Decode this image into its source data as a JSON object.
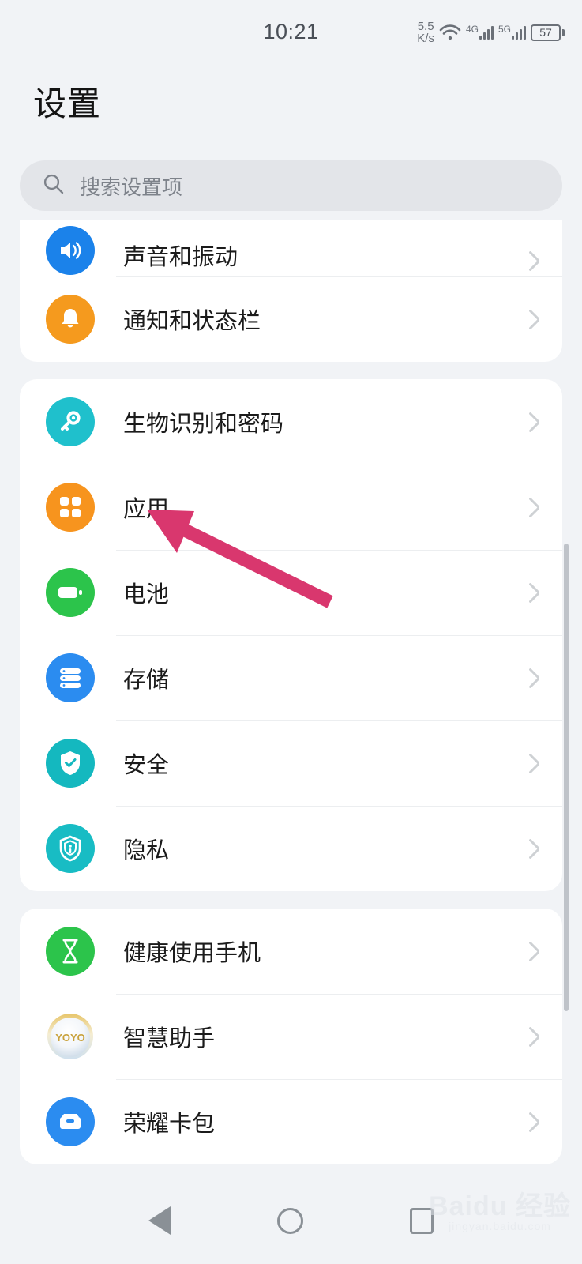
{
  "statusbar": {
    "clock": "10:21",
    "net_speed_value": "5.5",
    "net_speed_unit": "K/s",
    "wifi_icon": "wifi-icon",
    "sim1_network": "4G",
    "sim2_network": "5G",
    "battery_level": "57"
  },
  "header": {
    "title": "设置"
  },
  "search": {
    "placeholder": "搜索设置项",
    "icon": "search-icon"
  },
  "cards": [
    {
      "name": "card-sound-notifications",
      "rows": [
        {
          "label": "声音和振动",
          "icon": "speaker-icon",
          "color": "#1b82ea",
          "clipped": true
        },
        {
          "label": "通知和状态栏",
          "icon": "bell-icon",
          "color": "#f59a1e",
          "clipped": false
        }
      ]
    },
    {
      "name": "card-system-core",
      "rows": [
        {
          "label": "生物识别和密码",
          "icon": "key-icon",
          "color": "#1fc0cc",
          "clipped": false
        },
        {
          "label": "应用",
          "icon": "grid-apps-icon",
          "color": "#f7941e",
          "clipped": false
        },
        {
          "label": "电池",
          "icon": "battery-icon",
          "color": "#2cc44b",
          "clipped": false
        },
        {
          "label": "存储",
          "icon": "storage-icon",
          "color": "#2b8cf0",
          "clipped": false
        },
        {
          "label": "安全",
          "icon": "shield-check-icon",
          "color": "#14b8bf",
          "clipped": false
        },
        {
          "label": "隐私",
          "icon": "privacy-lock-icon",
          "color": "#18bcc4",
          "clipped": false
        }
      ]
    },
    {
      "name": "card-digital-balance",
      "rows": [
        {
          "label": "健康使用手机",
          "icon": "hourglass-icon",
          "color": "#2cc44b",
          "clipped": false
        },
        {
          "label": "智慧助手",
          "icon": "yoyo-assistant-icon",
          "color": "#e9edf2",
          "clipped": false
        },
        {
          "label": "荣耀卡包",
          "icon": "wallet-icon",
          "color": "#2b8cf0",
          "clipped": false
        }
      ]
    }
  ],
  "annotation": {
    "arrow_color": "#d9376e",
    "points_to": "应用"
  },
  "navbar": {
    "back": "back-triangle-icon",
    "home": "home-circle-icon",
    "recents": "recents-square-icon"
  },
  "watermark": {
    "main": "Baidu 经验",
    "sub": "jingyan.baidu.com"
  }
}
